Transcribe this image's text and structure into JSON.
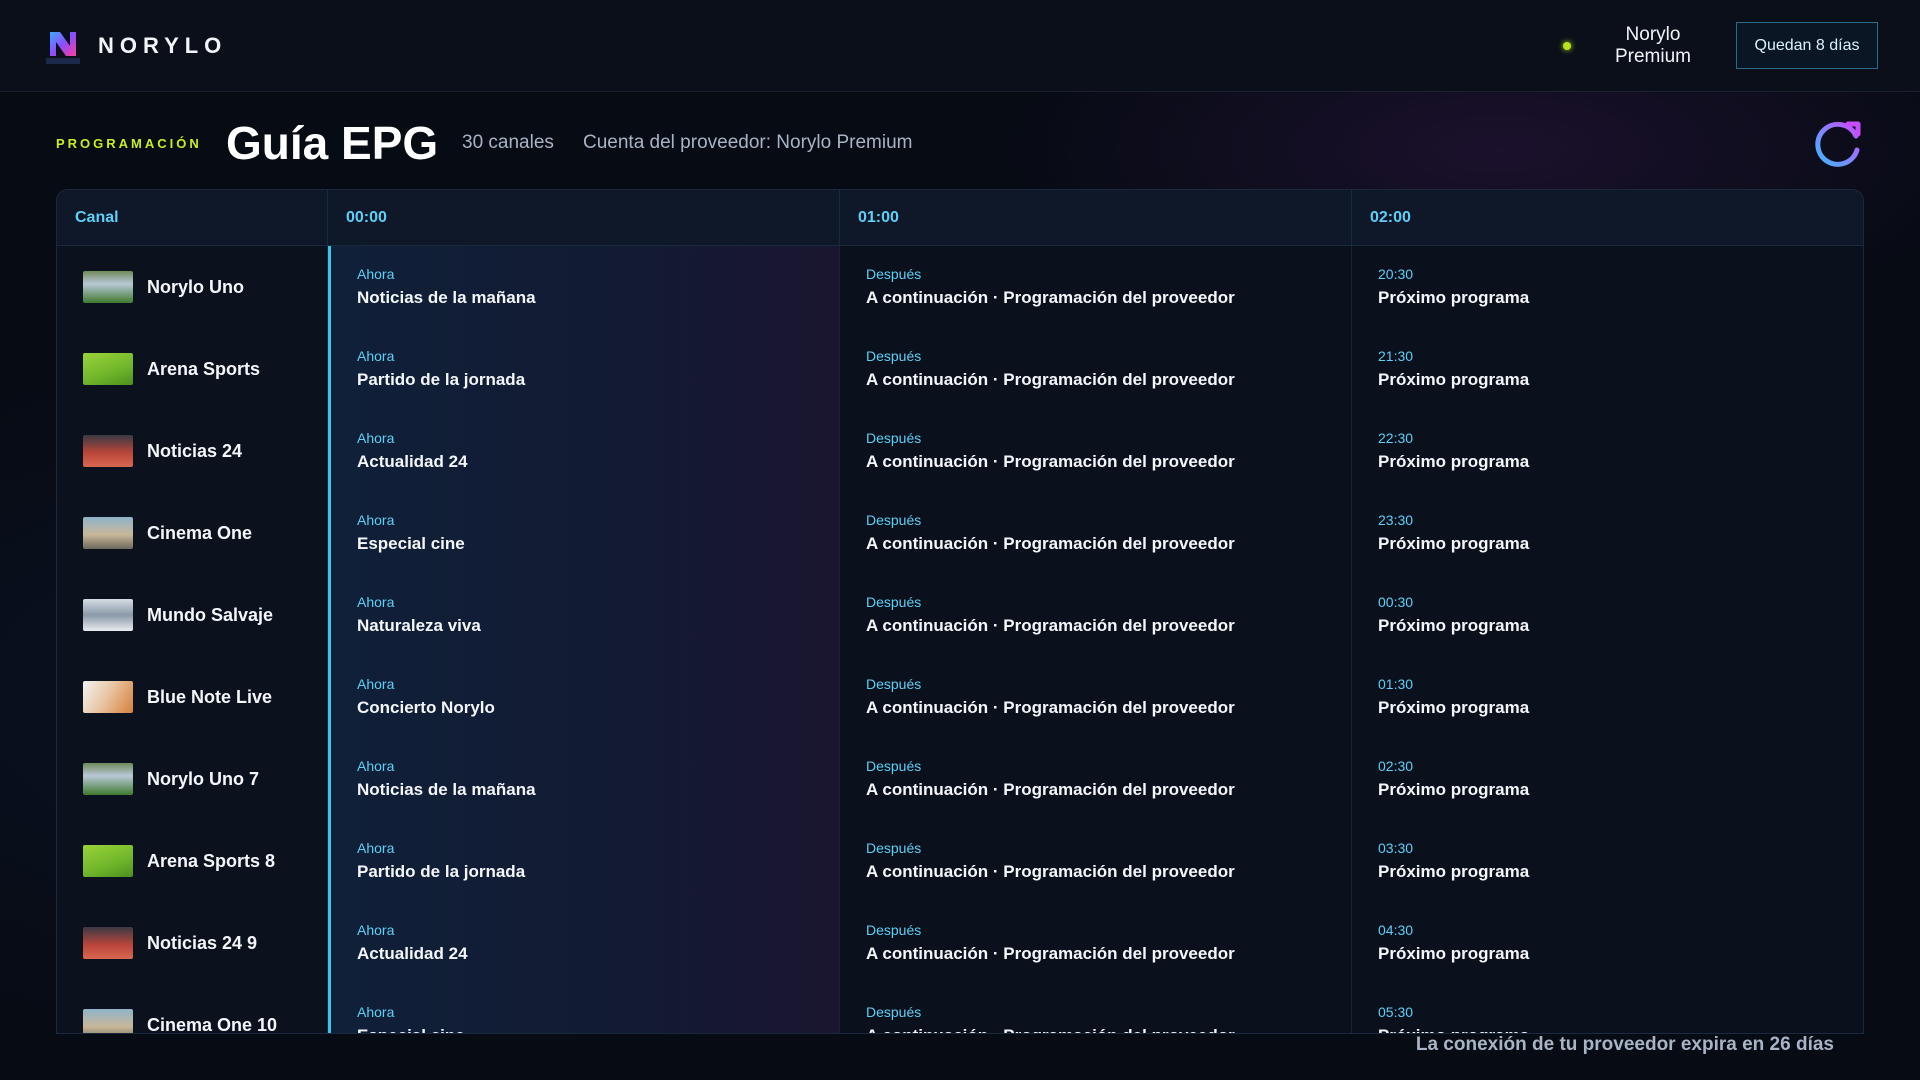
{
  "header": {
    "brand": "NORYLO",
    "logo_label": "NORYLO",
    "plan_name": "Norylo Premium",
    "days_left_label": "Quedan 8 días",
    "status_color": "#b5e61d"
  },
  "page": {
    "eyebrow": "PROGRAMACIÓN",
    "title": "Guía EPG",
    "channel_count": "30 canales",
    "provider_account": "Cuenta del proveedor: Norylo Premium",
    "refresh_icon": "refresh-icon"
  },
  "grid": {
    "columns": {
      "channel": "Canal",
      "t0": "00:00",
      "t1": "01:00",
      "t2": "02:00"
    },
    "rows": [
      {
        "channel": "Norylo Uno",
        "now_label": "Ahora",
        "now_title": "Noticias de la mañana",
        "next_label": "Después",
        "next_title": "A continuación · Programación del proveedor",
        "later_time": "20:30",
        "later_title": "Próximo programa"
      },
      {
        "channel": "Arena Sports",
        "now_label": "Ahora",
        "now_title": "Partido de la jornada",
        "next_label": "Después",
        "next_title": "A continuación · Programación del proveedor",
        "later_time": "21:30",
        "later_title": "Próximo programa"
      },
      {
        "channel": "Noticias 24",
        "now_label": "Ahora",
        "now_title": "Actualidad 24",
        "next_label": "Después",
        "next_title": "A continuación · Programación del proveedor",
        "later_time": "22:30",
        "later_title": "Próximo programa"
      },
      {
        "channel": "Cinema One",
        "now_label": "Ahora",
        "now_title": "Especial cine",
        "next_label": "Después",
        "next_title": "A continuación · Programación del proveedor",
        "later_time": "23:30",
        "later_title": "Próximo programa"
      },
      {
        "channel": "Mundo Salvaje",
        "now_label": "Ahora",
        "now_title": "Naturaleza viva",
        "next_label": "Después",
        "next_title": "A continuación · Programación del proveedor",
        "later_time": "00:30",
        "later_title": "Próximo programa"
      },
      {
        "channel": "Blue Note Live",
        "now_label": "Ahora",
        "now_title": "Concierto Norylo",
        "next_label": "Después",
        "next_title": "A continuación · Programación del proveedor",
        "later_time": "01:30",
        "later_title": "Próximo programa"
      },
      {
        "channel": "Norylo Uno 7",
        "now_label": "Ahora",
        "now_title": "Noticias de la mañana",
        "next_label": "Después",
        "next_title": "A continuación · Programación del proveedor",
        "later_time": "02:30",
        "later_title": "Próximo programa"
      },
      {
        "channel": "Arena Sports 8",
        "now_label": "Ahora",
        "now_title": "Partido de la jornada",
        "next_label": "Después",
        "next_title": "A continuación · Programación del proveedor",
        "later_time": "03:30",
        "later_title": "Próximo programa"
      },
      {
        "channel": "Noticias 24 9",
        "now_label": "Ahora",
        "now_title": "Actualidad 24",
        "next_label": "Después",
        "next_title": "A continuación · Programación del proveedor",
        "later_time": "04:30",
        "later_title": "Próximo programa"
      },
      {
        "channel": "Cinema One 10",
        "now_label": "Ahora",
        "now_title": "Especial cine",
        "next_label": "Después",
        "next_title": "A continuación · Programación del proveedor",
        "later_time": "05:30",
        "later_title": "Próximo programa"
      }
    ]
  },
  "footer": {
    "expiry_note": "La conexión de tu proveedor expira en 26 días"
  }
}
